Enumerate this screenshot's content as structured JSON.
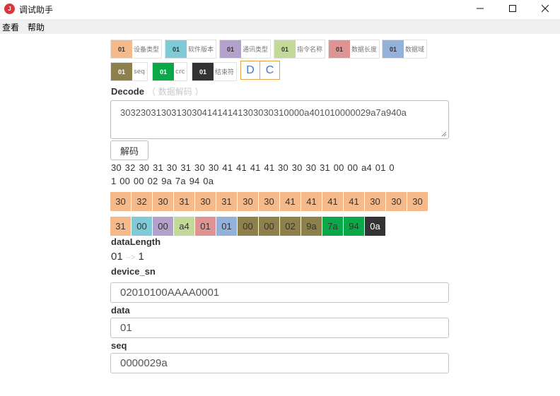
{
  "window": {
    "title": "调试助手",
    "icon_letter": "J"
  },
  "menu": [
    "查看",
    "帮助"
  ],
  "legend": [
    {
      "code": "01",
      "label": "设备类型",
      "color": "#f5b98a"
    },
    {
      "code": "01",
      "label": "软件版本",
      "color": "#7ecad6"
    },
    {
      "code": "01",
      "label": "通讯类型",
      "color": "#b3a0cb"
    },
    {
      "code": "01",
      "label": "指令名称",
      "color": "#c2d99a"
    },
    {
      "code": "01",
      "label": "数据长度",
      "color": "#e09393"
    },
    {
      "code": "01",
      "label": "数据域",
      "color": "#93b1d9"
    },
    {
      "code": "01",
      "label": "seq",
      "color": "#8e804a"
    },
    {
      "code": "01",
      "label": "crc",
      "color": "#0ba84a"
    },
    {
      "code": "01",
      "label": "结束符",
      "color": "#333333"
    }
  ],
  "dc_buttons": [
    "D",
    "C"
  ],
  "decode": {
    "title": "Decode",
    "subtitle": "（ 数据解码 ）",
    "input_value": "303230313031303041414141303030310000a401010000029a7a940a",
    "button": "解码"
  },
  "bytes_text": {
    "line1": "30 32 30 31 30 31 30 30 41 41 41 41 30 30 30 31 00 00 a4 01 0",
    "line2": "1 00 00 02 9a 7a 94 0a"
  },
  "byte_rows": [
    [
      {
        "v": "30",
        "c": "#f5b98a"
      },
      {
        "v": "32",
        "c": "#f5b98a"
      },
      {
        "v": "30",
        "c": "#f5b98a"
      },
      {
        "v": "31",
        "c": "#f5b98a"
      },
      {
        "v": "30",
        "c": "#f5b98a"
      },
      {
        "v": "31",
        "c": "#f5b98a"
      },
      {
        "v": "30",
        "c": "#f5b98a"
      },
      {
        "v": "30",
        "c": "#f5b98a"
      },
      {
        "v": "41",
        "c": "#f5b98a"
      },
      {
        "v": "41",
        "c": "#f5b98a"
      },
      {
        "v": "41",
        "c": "#f5b98a"
      },
      {
        "v": "41",
        "c": "#f5b98a"
      },
      {
        "v": "30",
        "c": "#f5b98a"
      },
      {
        "v": "30",
        "c": "#f5b98a"
      },
      {
        "v": "30",
        "c": "#f5b98a"
      }
    ],
    [
      {
        "v": "31",
        "c": "#f5b98a"
      },
      {
        "v": "00",
        "c": "#7ecad6"
      },
      {
        "v": "00",
        "c": "#b3a0cb"
      },
      {
        "v": "a4",
        "c": "#c2d99a"
      },
      {
        "v": "01",
        "c": "#e09393"
      },
      {
        "v": "01",
        "c": "#93b1d9"
      },
      {
        "v": "00",
        "c": "#8e804a"
      },
      {
        "v": "00",
        "c": "#8e804a"
      },
      {
        "v": "02",
        "c": "#8e804a"
      },
      {
        "v": "9a",
        "c": "#8e804a"
      },
      {
        "v": "7a",
        "c": "#0ba84a"
      },
      {
        "v": "94",
        "c": "#0ba84a"
      },
      {
        "v": "0a",
        "c": "#333333",
        "fg": "#ffffff"
      }
    ]
  ],
  "fields": {
    "data_length": {
      "label": "dataLength",
      "raw": "01",
      "arrow": "-->",
      "decoded": "1"
    },
    "device_sn": {
      "label": "device_sn",
      "value": "02010100AAAA0001"
    },
    "data": {
      "label": "data",
      "value": "01"
    },
    "seq": {
      "label": "seq",
      "value": "0000029a"
    }
  }
}
